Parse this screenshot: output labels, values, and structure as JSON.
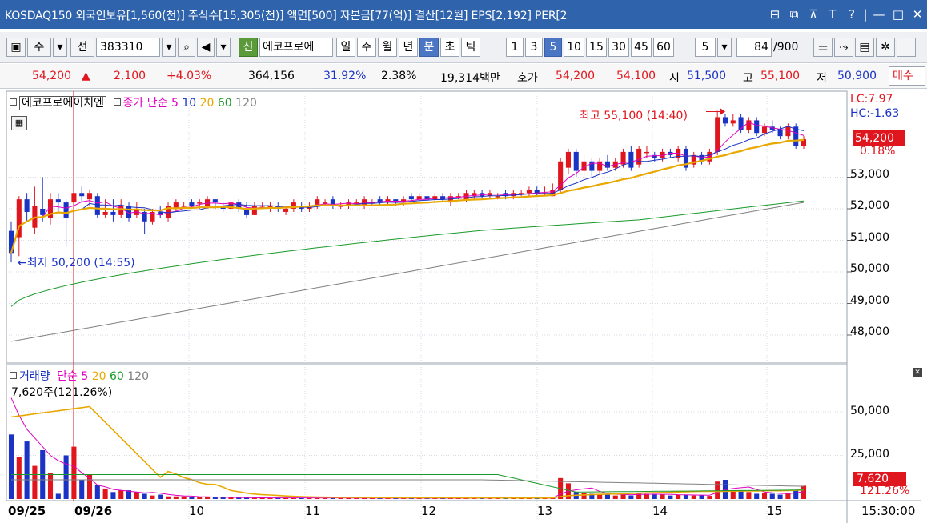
{
  "titlebar": {
    "text": "KOSDAQ150 외국인보유[1,560(천)] 주식수[15,305(천)] 액면[500] 자본금[77(억)] 결산[12월] EPS[2,192] PER[2",
    "controls": [
      "⊟",
      "⧉",
      "⊼",
      "T",
      "?",
      "|",
      "—",
      "□",
      "✕"
    ]
  },
  "toolbar": {
    "prefix1": "주",
    "prefix2": "전",
    "code": "383310",
    "stock_tag": "신",
    "stock_name": "에코프로에",
    "period_buttons": [
      "일",
      "주",
      "월",
      "년",
      "분",
      "초",
      "틱"
    ],
    "selected_period": "분",
    "interval_buttons": [
      "1",
      "3",
      "5",
      "10",
      "15",
      "30",
      "45",
      "60"
    ],
    "selected_interval": "5",
    "interval_value": "5",
    "count": "84",
    "count_max": "/900"
  },
  "quote": {
    "price": "54,200",
    "change_arrow": "▲",
    "change": "2,100",
    "change_pct": "+4.03%",
    "volume": "364,156",
    "ratio": "31.92%",
    "turnover": "2.38%",
    "amount": "19,314백만",
    "hoga_label": "호가",
    "ask": "54,200",
    "bid": "54,100",
    "open_label": "시",
    "open": "51,500",
    "high_label": "고",
    "high": "55,100",
    "low_label": "저",
    "low": "50,900",
    "buy_label": "매수"
  },
  "price_panel": {
    "stock_label": "에코프로에이치엔",
    "ma_label": "종가 단순",
    "ma_periods": [
      "5",
      "10",
      "20",
      "60",
      "120"
    ],
    "ma_colors": [
      "#e000c0",
      "#1a33c4",
      "#e8a800",
      "#1a9a2a",
      "#808080"
    ],
    "lc": "LC:7.97",
    "hc": "HC:-1.63",
    "current_price": "54,200",
    "current_pct": "0.18%",
    "high_annotation": "최고 55,100 (14:40)",
    "low_annotation": "←최저 50,200 (14:55)",
    "y_ticks": [
      "53,000",
      "52,000",
      "51,000",
      "50,000",
      "49,000",
      "48,000"
    ]
  },
  "volume_panel": {
    "label": "거래량",
    "ma_label": "단순",
    "ma_periods": [
      "5",
      "20",
      "60",
      "120"
    ],
    "info": "7,620주(121.26%)",
    "y_ticks": [
      "50,000",
      "25,000"
    ],
    "current": "7,620",
    "current_pct": "121.26%"
  },
  "x_axis": {
    "labels": [
      "09/25",
      "09/26",
      "10",
      "11",
      "12",
      "13",
      "14",
      "15"
    ],
    "time": "15:30:00"
  },
  "colors": {
    "up": "#e0161e",
    "down": "#1a33c4",
    "title_bg": "#2f63ab",
    "grid": "#d6dbe4"
  }
}
